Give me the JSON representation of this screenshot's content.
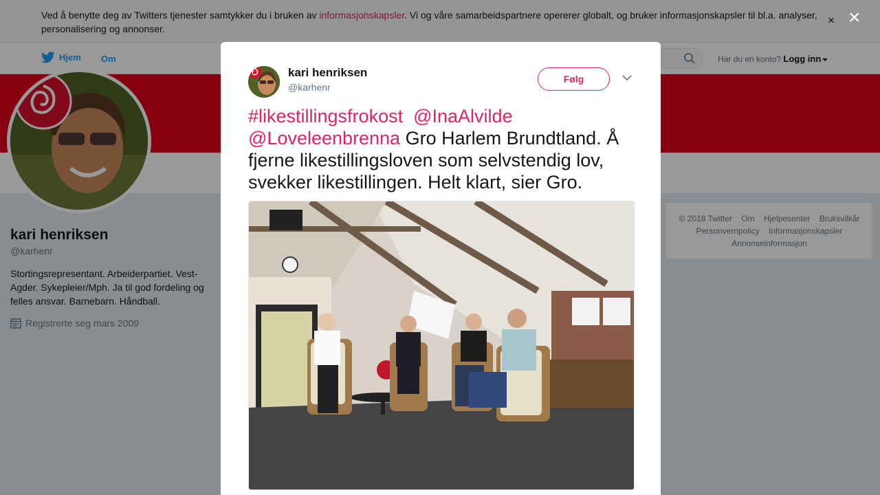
{
  "cookie_banner": {
    "text_before": "Ved å benytte deg av Twitters tjenester samtykker du i bruken av ",
    "link": "informasjonskapsler",
    "text_after": ". Vi og våre samarbeidspartnere opererer globalt, og bruker informasjonskapsler til bl.a. analyser, personalisering og annonser.",
    "close": "×"
  },
  "nav": {
    "home": "Hjem",
    "about": "Om",
    "login_prompt": "Har du en konto?",
    "login": "Logg inn"
  },
  "profile": {
    "name": "kari henriksen",
    "handle": "@karhenr",
    "bio": "Stortingsrepresentant. Arbeiderpartiet. Vest-Agder. Sykepleier/Mph. Ja til god fordeling og felles ansvar. Barnebarn. Håndball.",
    "joined": "Registrerte seg mars 2009"
  },
  "footer": {
    "copyright": "© 2018 Twitter",
    "about": "Om",
    "help": "Hjelpesenter",
    "terms": "Bruksvilkår",
    "privacy": "Personvernpolicy",
    "cookies": "Informasjonskapsler",
    "ads": "Annonseinformasjon"
  },
  "overlay": {
    "close": "×"
  },
  "tweet": {
    "name": "kari henriksen",
    "handle": "@karhenr",
    "follow": "Følg",
    "hashtag": "#likestillingsfrokost",
    "mention1": "@InaAlvilde",
    "mention2": "@Loveleenbrenna",
    "body": " Gro Harlem Brundtland. Å fjerne likestillingsloven som selvstendig lov, svekker likestillingen. Helt klart, sier Gro."
  },
  "colors": {
    "brand_red": "#e0001a",
    "link_pink": "#e0245e",
    "twitter_blue": "#1da1f2"
  },
  "icons": [
    "twitter-bird-icon",
    "search-icon",
    "calendar-icon",
    "close-icon",
    "chevron-down-icon"
  ]
}
